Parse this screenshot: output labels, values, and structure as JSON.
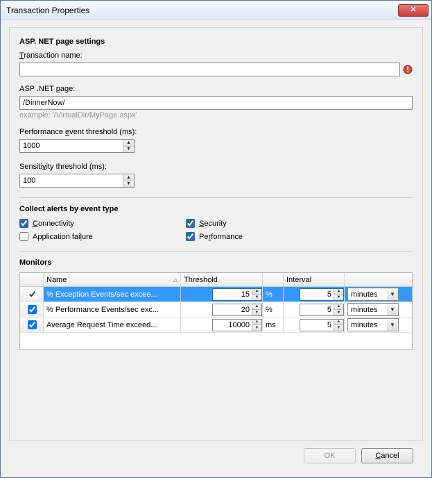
{
  "window": {
    "title": "Transaction Properties"
  },
  "section1": {
    "heading": "ASP. NET page settings",
    "transaction_name_label_pre": "",
    "transaction_name_u": "T",
    "transaction_name_label_post": "ransaction name:",
    "transaction_name_value": "",
    "asp_page_label_pre": "ASP .NET ",
    "asp_page_u": "p",
    "asp_page_label_post": "age:",
    "asp_page_value": "/DinnerNow/",
    "asp_page_hint": "example: '/VirtualDir/MyPage.aspx'",
    "perf_thresh_label_pre": "Performance ",
    "perf_thresh_u": "e",
    "perf_thresh_label_post": "vent threshold (ms):",
    "perf_thresh_value": "1000",
    "sens_thresh_label_pre": "Sensiti",
    "sens_thresh_u": "v",
    "sens_thresh_label_post": "ity threshold (ms):",
    "sens_thresh_value": "100"
  },
  "section2": {
    "heading": "Collect alerts by event type",
    "connectivity_pre": "",
    "connectivity_u": "C",
    "connectivity_post": "onnectivity",
    "security_pre": "",
    "security_u": "S",
    "security_post": "ecurity",
    "appfail_pre": "Application fai",
    "appfail_u": "l",
    "appfail_post": "ure",
    "perf_pre": "Pe",
    "perf_u": "r",
    "perf_post": "formance"
  },
  "section3": {
    "heading": "Monitors",
    "cols": {
      "name": "Name",
      "threshold": "Threshold",
      "interval": "Interval"
    },
    "rows": [
      {
        "checked": true,
        "name": "% Exception Events/sec excee...",
        "threshold": "15",
        "unit": "%",
        "interval": "5",
        "interval_unit": "minutes",
        "selected": true
      },
      {
        "checked": true,
        "name": "% Performance Events/sec exc...",
        "threshold": "20",
        "unit": "%",
        "interval": "5",
        "interval_unit": "minutes",
        "selected": false
      },
      {
        "checked": true,
        "name": "Average Request Time exceed...",
        "threshold": "10000",
        "unit": "ms",
        "interval": "5",
        "interval_unit": "minutes",
        "selected": false
      }
    ]
  },
  "footer": {
    "ok": "OK",
    "cancel_u": "C",
    "cancel_post": "ancel"
  }
}
